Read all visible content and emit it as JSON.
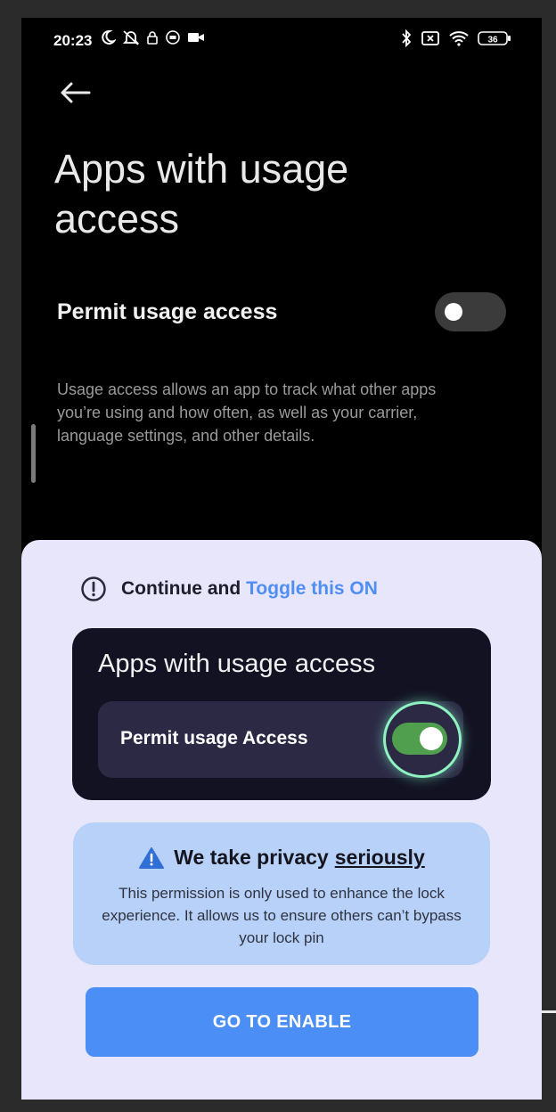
{
  "status_bar": {
    "time": "20:23",
    "battery": "36",
    "left_icons": [
      "moon-icon",
      "notifications-off-icon",
      "lock-icon",
      "shield-icon",
      "video-icon"
    ],
    "right_icons": [
      "bluetooth-icon",
      "no-sim-icon",
      "wifi-icon",
      "battery-icon"
    ]
  },
  "settings_page": {
    "title": "Apps with usage access",
    "setting_label": "Permit usage access",
    "toggle_on": false,
    "description": "Usage access allows an app to track what other apps you’re using and how often, as well as your carrier, language settings, and other details."
  },
  "sheet": {
    "instruction_prefix": "Continue and",
    "instruction_accent": "Toggle this ON",
    "demo_card": {
      "title": "Apps with usage access",
      "row_label": "Permit usage Access",
      "toggle_on": true
    },
    "privacy": {
      "heading_prefix": "We take privacy",
      "heading_underlined": "seriously",
      "body": "This permission is only used to enhance the lock experience. It allows us to ensure others can’t bypass your lock pin"
    },
    "button_label": "GO TO ENABLE"
  },
  "colors": {
    "accent": "#4f8ff3",
    "sheet_bg": "#e8e6fb",
    "toggle_on": "#4f9f4f",
    "button": "#4a8ef6",
    "privacy_bg": "#b8d1f8"
  }
}
